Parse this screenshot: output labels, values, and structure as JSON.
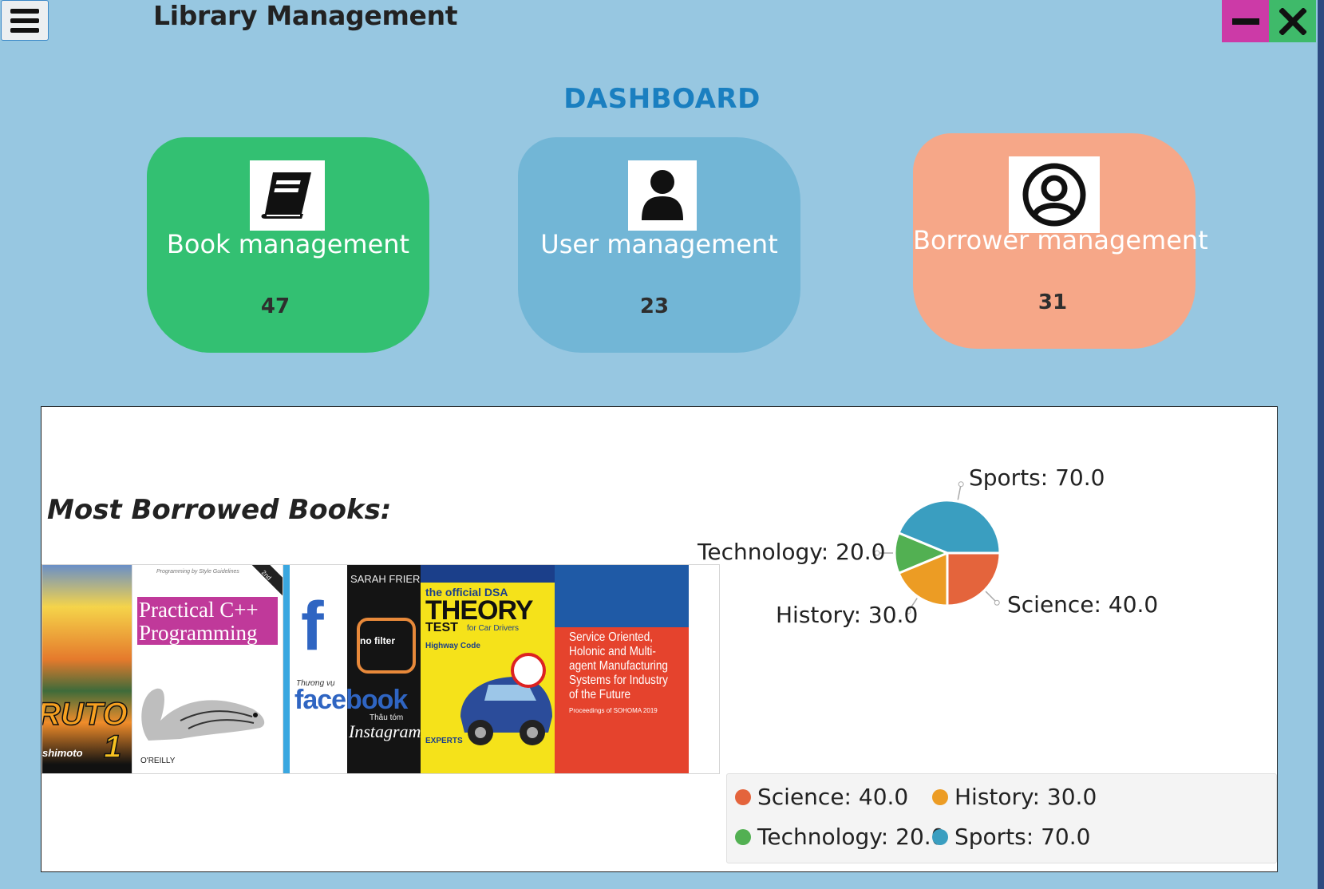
{
  "app": {
    "title": "Library Management"
  },
  "window": {
    "minimize_icon": "minus-icon",
    "close_icon": "close-icon",
    "menu_icon": "hamburger-icon"
  },
  "dashboard": {
    "heading": "DASHBOARD",
    "cards": [
      {
        "label": "Book management",
        "count": "47",
        "icon": "book-icon",
        "color": "#33c072"
      },
      {
        "label": "User management",
        "count": "23",
        "icon": "user-icon",
        "color": "#72b6d6"
      },
      {
        "label": "Borrower management",
        "count": "31",
        "icon": "user-circle-icon",
        "color": "#f6a788"
      }
    ]
  },
  "most_borrowed": {
    "heading": "Most Borrowed Books:",
    "covers": [
      {
        "title": "Naruto",
        "text": "RUTO",
        "sub": "shimoto",
        "volume": "1"
      },
      {
        "title": "Practical C++ Programming",
        "line1": "Practical C++",
        "line2": "Programming",
        "tag": "Programming by Style Guidelines",
        "edition": "2nd Edition",
        "publisher": "O'REILLY"
      },
      {
        "title": "Thương vụ facebook Thâu tóm Instagram",
        "author": "SARAH FRIER",
        "big": "facebook",
        "prefix": "Thương vụ",
        "suffix": "Thâu tóm",
        "script": "Instagram",
        "badge": "no filter"
      },
      {
        "title": "The official DSA Theory Test",
        "top": "the official DSA",
        "main": "THEORY",
        "main2": "TEST",
        "for": "for Car Drivers",
        "code": "Highway Code",
        "experts": "EXPERTS"
      },
      {
        "title": "Service Oriented, Holonic and Multi-agent Manufacturing Systems for Industry of the Future",
        "line1": "Service Oriented,",
        "line2": "Holonic and Multi-",
        "line3": "agent Manufacturing",
        "line4": "Systems for Industry",
        "line5": "of the Future",
        "foot": "Proceedings of SOHOMA 2019"
      }
    ]
  },
  "chart_data": {
    "type": "pie",
    "slices": [
      {
        "label": "Science",
        "value": 40.0,
        "display": "Science: 40.0",
        "color": "#e4643c"
      },
      {
        "label": "History",
        "value": 30.0,
        "display": "History: 30.0",
        "color": "#ec9c24"
      },
      {
        "label": "Technology",
        "value": 20.0,
        "display": "Technology: 20.0",
        "color": "#52b052"
      },
      {
        "label": "Sports",
        "value": 70.0,
        "display": "Sports: 70.0",
        "color": "#3a9ec0"
      }
    ],
    "legend_position": "bottom"
  }
}
